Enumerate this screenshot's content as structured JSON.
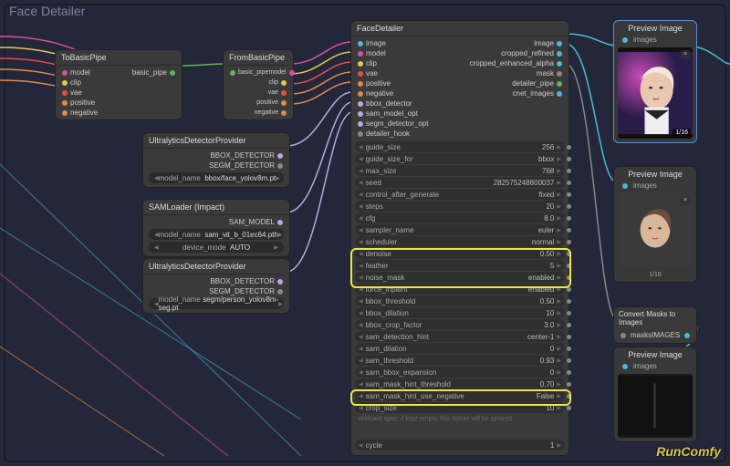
{
  "app": {
    "title": "Face Detailer",
    "logo": "RunComfy"
  },
  "nodes": {
    "toBasicPipe": {
      "title": "ToBasicPipe",
      "inputs": [
        "model",
        "clip",
        "vae",
        "positive",
        "negative"
      ],
      "outputs": [
        "basic_pipe"
      ]
    },
    "fromBasicPipe": {
      "title": "FromBasicPipe",
      "inputs": [
        "basic_pipe"
      ],
      "outputs": [
        "model",
        "clip",
        "vae",
        "positive",
        "negative"
      ]
    },
    "udp1": {
      "title": "UltralyticsDetectorProvider",
      "outputs": [
        "BBOX_DETECTOR",
        "SEGM_DETECTOR"
      ],
      "field": {
        "label": "model_name",
        "value": "bbox/face_yolov8m.pt"
      }
    },
    "sam": {
      "title": "SAMLoader (Impact)",
      "outputs": [
        "SAM_MODEL"
      ],
      "fields": [
        {
          "label": "model_name",
          "value": "sam_vit_b_01ec64.pth"
        },
        {
          "label": "device_mode",
          "value": "AUTO"
        }
      ]
    },
    "udp2": {
      "title": "UltralyticsDetectorProvider",
      "outputs": [
        "BBOX_DETECTOR",
        "SEGM_DETECTOR"
      ],
      "field": {
        "label": "model_name",
        "value": "segm/person_yolov8m-seg.pt"
      }
    },
    "faceDetailer": {
      "title": "FaceDetailer",
      "inputs_left": [
        "image",
        "model",
        "clip",
        "vae",
        "positive",
        "negative",
        "bbox_detector",
        "sam_model_opt",
        "segm_detector_opt",
        "detailer_hook"
      ],
      "outputs_right": [
        "image",
        "cropped_refined",
        "cropped_enhanced_alpha",
        "mask",
        "detailer_pipe",
        "cnet_images"
      ],
      "params": [
        {
          "l": "guide_size",
          "v": "256"
        },
        {
          "l": "guide_size_for",
          "v": "bbox"
        },
        {
          "l": "max_size",
          "v": "768"
        },
        {
          "l": "seed",
          "v": "282575248800037"
        },
        {
          "l": "control_after_generate",
          "v": "fixed"
        },
        {
          "l": "steps",
          "v": "20"
        },
        {
          "l": "cfg",
          "v": "8.0"
        },
        {
          "l": "sampler_name",
          "v": "euler"
        },
        {
          "l": "scheduler",
          "v": "normal"
        },
        {
          "l": "denoise",
          "v": "0.50"
        },
        {
          "l": "feather",
          "v": "5"
        },
        {
          "l": "noise_mask",
          "v": "enabled"
        },
        {
          "l": "force_inpaint",
          "v": "enabled"
        },
        {
          "l": "bbox_threshold",
          "v": "0.50"
        },
        {
          "l": "bbox_dilation",
          "v": "10"
        },
        {
          "l": "bbox_crop_factor",
          "v": "3.0"
        },
        {
          "l": "sam_detection_hint",
          "v": "center-1"
        },
        {
          "l": "sam_dilation",
          "v": "0"
        },
        {
          "l": "sam_threshold",
          "v": "0.93"
        },
        {
          "l": "sam_bbox_expansion",
          "v": "0"
        },
        {
          "l": "sam_mask_hint_threshold",
          "v": "0.70"
        },
        {
          "l": "sam_mask_hint_use_negative",
          "v": "False"
        },
        {
          "l": "crop_size",
          "v": "10"
        }
      ],
      "note": "wildcard spec: if kept empty, this option will be ignored",
      "cycle": {
        "label": "cycle",
        "value": "1"
      }
    },
    "preview1": {
      "title": "Preview Image",
      "port": "images",
      "badge": "1/16"
    },
    "preview2": {
      "title": "Preview Image",
      "port": "images",
      "badge": "1/16"
    },
    "convert": {
      "title": "Convert Masks to Images",
      "in": "masks",
      "out": "IMAGES"
    },
    "preview3": {
      "title": "Preview Image",
      "port": "images"
    }
  }
}
